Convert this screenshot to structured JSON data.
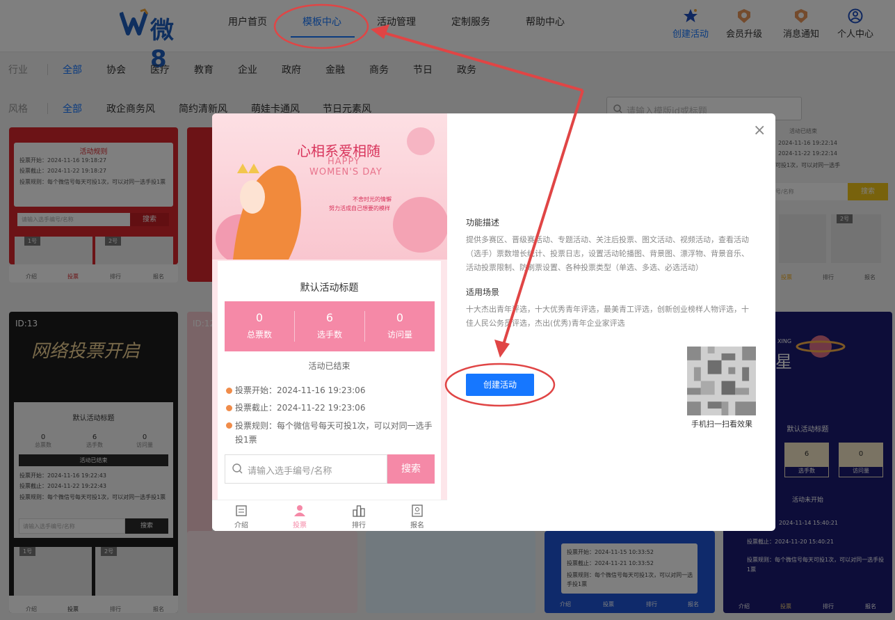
{
  "header": {
    "logo_text": "微8",
    "nav": [
      "用户首页",
      "模板中心",
      "活动管理",
      "定制服务",
      "帮助中心"
    ],
    "active_nav": "模板中心",
    "icons": [
      {
        "label": "创建活动",
        "icon": "star-icon"
      },
      {
        "label": "会员升级",
        "icon": "medal-icon"
      },
      {
        "label": "消息通知",
        "icon": "bell-medal-icon"
      },
      {
        "label": "个人中心",
        "icon": "user-icon"
      }
    ],
    "accent_color": "#1677ff"
  },
  "filters": {
    "industry_label": "行业",
    "industry": [
      "全部",
      "协会",
      "医疗",
      "教育",
      "企业",
      "政府",
      "金融",
      "商务",
      "节日",
      "政务"
    ],
    "style_label": "风格",
    "style": [
      "全部",
      "政企商务风",
      "简约清新风",
      "萌娃卡通风",
      "节日元素风"
    ],
    "search_placeholder": "请输入模版id或标题"
  },
  "background_cards": {
    "card1": {
      "rule_title": "活动规则",
      "start": "投票开始：2024-11-16 19:18:27",
      "end": "投票截止：2024-11-22 19:18:27",
      "rule": "投票规则：每个微信号每天可投1次，可以对同一选手投1票",
      "search_placeholder": "请输入选手编号/名称",
      "search_btn": "搜索",
      "tabs": [
        "介绍",
        "投票",
        "排行",
        "报名"
      ],
      "tags": [
        "1号",
        "2号"
      ]
    },
    "card2": {
      "id": "ID:13",
      "banner_title": "网络投票开启",
      "title": "默认活动标题",
      "stats": [
        {
          "num": "0",
          "lbl": "总票数"
        },
        {
          "num": "6",
          "lbl": "选手数"
        },
        {
          "num": "0",
          "lbl": "访问量"
        }
      ],
      "status": "活动已结束",
      "start": "投票开始：2024-11-16 19:22:43",
      "end": "投票截止：2024-11-22 19:22:43",
      "rule": "投票规则：每个微信号每天可投1次，可以对同一选手投1票",
      "search_placeholder": "请输入选手编号/名称",
      "search_btn": "搜索",
      "tabs": [
        "介绍",
        "投票",
        "排行",
        "报名"
      ],
      "tags": [
        "1号",
        "2号"
      ]
    },
    "card3": {
      "id": "ID:12"
    },
    "card4": {
      "start": "投票开始：2024-11-15 10:33:52",
      "end": "投票截止：2024-11-21 10:33:52",
      "rule": "投票规则：每个微信号每天可投1次，可以对同一选手投1票",
      "tabs": [
        "介绍",
        "投票",
        "排行",
        "报名"
      ]
    },
    "card5": {
      "status": "活动已结束",
      "start": "2024-11-16 19:22:14",
      "end": "2024-11-22 19:22:14",
      "rule": "可投1次，可以对同一选手",
      "search_placeholder": "号/名称",
      "search_btn": "搜索",
      "tabs": [
        "投票",
        "排行",
        "报名"
      ],
      "tags": [
        "2号"
      ]
    },
    "card6": {
      "brand": "XING",
      "banner_title": "星",
      "title": "默认活动标题",
      "stats": [
        {
          "num": "6",
          "lbl": "选手数"
        },
        {
          "num": "0",
          "lbl": "访问量"
        }
      ],
      "status": "活动未开始",
      "start": "2024-11-14 15:40:21",
      "end": "投票截止：2024-11-20 15:40:21",
      "rule": "投票规则：每个微信号每天可投1次，可以对同一选手投1票",
      "tabs": [
        "介绍",
        "投票",
        "排行",
        "报名"
      ]
    }
  },
  "modal": {
    "preview": {
      "banner_title": "心相系爱相随",
      "banner_en1": "HAPPY",
      "banner_en2": "WOMEN'S DAY",
      "banner_sub1": "不舍时光的情懈",
      "banner_sub2": "努力活成自己想要的模样",
      "title": "默认活动标题",
      "stats": [
        {
          "num": "0",
          "lbl": "总票数"
        },
        {
          "num": "6",
          "lbl": "选手数"
        },
        {
          "num": "0",
          "lbl": "访问量"
        }
      ],
      "status": "活动已结束",
      "start": "投票开始：2024-11-16 19:23:06",
      "end": "投票截止：2024-11-22 19:23:06",
      "rule": "投票规则：每个微信号每天可投1次，可以对同一选手投1票",
      "search_placeholder": "请输入选手编号/名称",
      "search_btn": "搜索",
      "tabs": [
        "介绍",
        "投票",
        "排行",
        "报名"
      ],
      "active_tab": "投票",
      "accent_color": "#f589a7"
    },
    "feature_title": "功能描述",
    "feature_desc": "提供多赛区、晋级赛活动、专题活动、关注后投票、图文活动、视频活动，查看活动（选手）票数增长统计、投票日志，设置活动轮播图、背景图、漂浮物、背景音乐、活动投票限制、防刷票设置、各种投票类型（单选、多选、必选活动）",
    "scene_title": "适用场景",
    "scene_desc": "十大杰出青年评选，十大优秀青年评选，最美青工评选，创新创业榜样人物评选，十佳人民公务员评选，杰出(优秀)青年企业家评选",
    "create_btn": "创建活动",
    "qr_caption": "手机扫一扫看效果",
    "close": "×"
  },
  "annotation_color": "#e04545"
}
